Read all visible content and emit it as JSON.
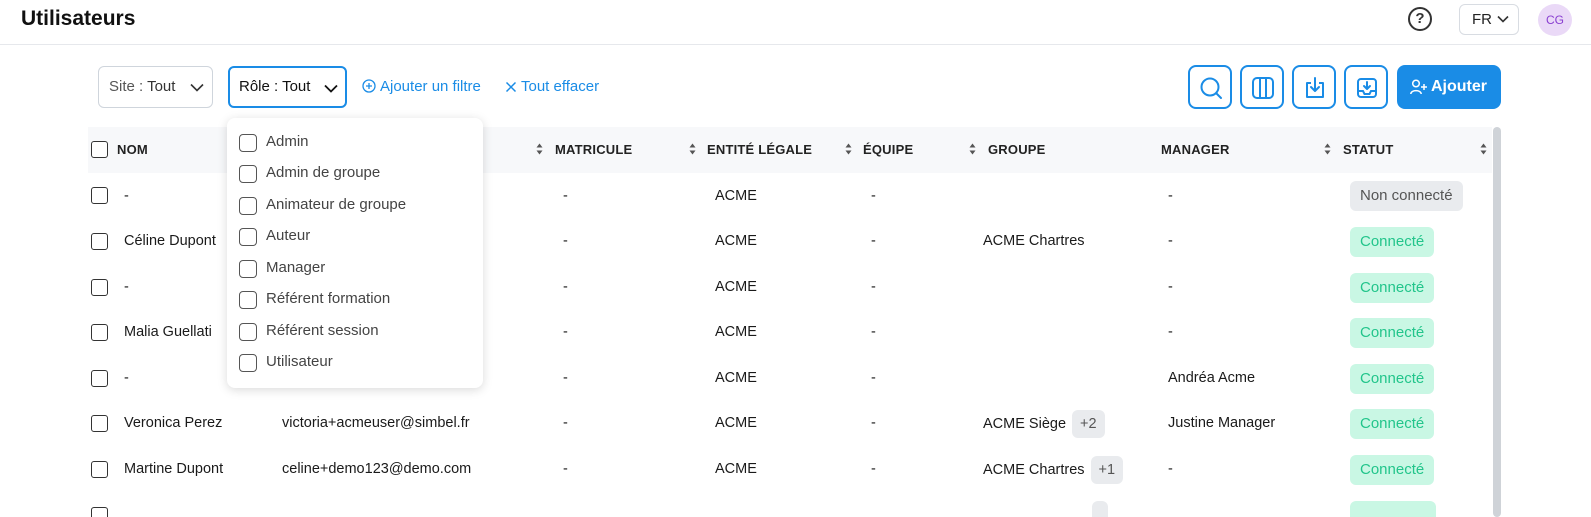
{
  "header": {
    "title": "Utilisateurs",
    "help_label": "?",
    "language": "FR",
    "avatar_initials": "CG"
  },
  "filters": {
    "site": {
      "label": "Site :",
      "value": "Tout"
    },
    "role": {
      "label": "Rôle :",
      "value": "Tout"
    },
    "add_filter_label": "Ajouter un filtre",
    "clear_all_label": "Tout effacer"
  },
  "toolbar": {
    "add_label": "Ajouter",
    "icons": [
      "search-icon",
      "columns-icon",
      "download-icon",
      "import-icon",
      "add-user-icon"
    ]
  },
  "role_dropdown": {
    "options": [
      "Admin",
      "Admin de groupe",
      "Animateur de groupe",
      "Auteur",
      "Manager",
      "Référent formation",
      "Référent session",
      "Utilisateur"
    ]
  },
  "table": {
    "columns": [
      "NOM",
      "MATRICULE",
      "ENTITÉ LÉGALE",
      "ÉQUIPE",
      "GROUPE",
      "MANAGER",
      "STATUT"
    ],
    "rows": [
      {
        "name": "-",
        "email": "",
        "matricule": "-",
        "entity": "ACME",
        "team": "-",
        "group": "",
        "group_more": "",
        "manager": "-",
        "status": "Non connecté",
        "connected": false
      },
      {
        "name": "Céline Dupont",
        "email": "",
        "matricule": "-",
        "entity": "ACME",
        "team": "-",
        "group": "ACME Chartres",
        "group_more": "",
        "manager": "-",
        "status": "Connecté",
        "connected": true
      },
      {
        "name": "-",
        "email": "",
        "matricule": "-",
        "entity": "ACME",
        "team": "-",
        "group": "",
        "group_more": "",
        "manager": "-",
        "status": "Connecté",
        "connected": true
      },
      {
        "name": "Malia Guellati",
        "email": "",
        "matricule": "-",
        "entity": "ACME",
        "team": "-",
        "group": "",
        "group_more": "",
        "manager": "-",
        "status": "Connecté",
        "connected": true
      },
      {
        "name": "-",
        "email": "",
        "matricule": "-",
        "entity": "ACME",
        "team": "-",
        "group": "",
        "group_more": "",
        "manager": "Andréa Acme",
        "status": "Connecté",
        "connected": true
      },
      {
        "name": "Veronica Perez",
        "email": "victoria+acmeuser@simbel.fr",
        "matricule": "-",
        "entity": "ACME",
        "team": "-",
        "group": "ACME Siège",
        "group_more": "+2",
        "manager": "Justine Manager",
        "status": "Connecté",
        "connected": true
      },
      {
        "name": "Martine Dupont",
        "email": "celine+demo123@demo.com",
        "matricule": "-",
        "entity": "ACME",
        "team": "-",
        "group": "ACME Chartres",
        "group_more": "+1",
        "manager": "-",
        "status": "Connecté",
        "connected": true
      }
    ]
  }
}
